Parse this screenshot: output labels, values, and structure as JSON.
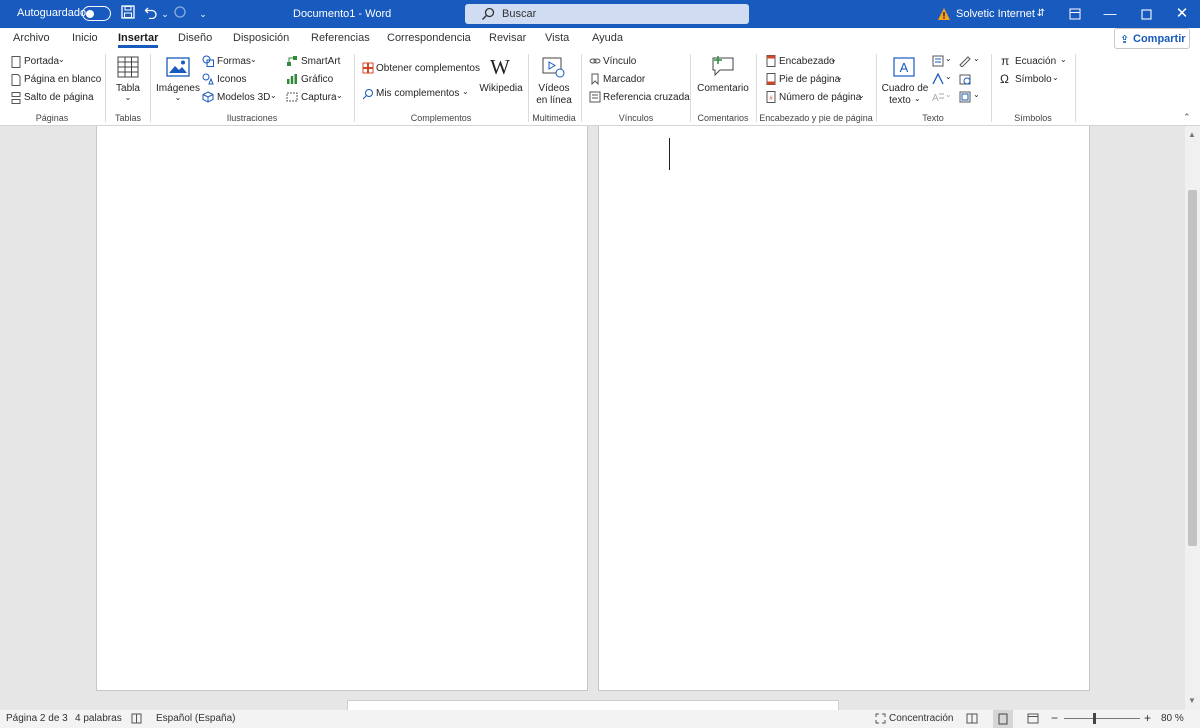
{
  "titlebar": {
    "autosave_label": "Autoguardado",
    "doc_title": "Documento1  -  Word",
    "search_placeholder": "Buscar",
    "user_name": "Solvetic Internet"
  },
  "tabs": [
    "Archivo",
    "Inicio",
    "Insertar",
    "Diseño",
    "Disposición",
    "Referencias",
    "Correspondencia",
    "Revisar",
    "Vista",
    "Ayuda"
  ],
  "active_tab": "Insertar",
  "share_label": "Compartir",
  "ribbon": {
    "paginas": {
      "label": "Páginas",
      "portada": "Portada",
      "pagina_blanco": "Página en blanco",
      "salto": "Salto de página"
    },
    "tablas": {
      "label": "Tablas",
      "tabla": "Tabla"
    },
    "ilustraciones": {
      "label": "Ilustraciones",
      "imagenes": "Imágenes",
      "formas": "Formas",
      "iconos": "Iconos",
      "modelos3d": "Modelos 3D",
      "smartart": "SmartArt",
      "grafico": "Gráfico",
      "captura": "Captura"
    },
    "complementos": {
      "label": "Complementos",
      "obtener": "Obtener complementos",
      "mis": "Mis complementos",
      "wikipedia": "Wikipedia"
    },
    "multimedia": {
      "label": "Multimedia",
      "videos_1": "Vídeos",
      "videos_2": "en línea"
    },
    "vinculos": {
      "label": "Vínculos",
      "vinculo": "Vínculo",
      "marcador": "Marcador",
      "referencia": "Referencia cruzada"
    },
    "comentarios": {
      "label": "Comentarios",
      "comentario": "Comentario"
    },
    "encabezado": {
      "label": "Encabezado y pie de página",
      "encabezado": "Encabezado",
      "pie": "Pie de página",
      "numero": "Número de página"
    },
    "texto": {
      "label": "Texto",
      "cuadro_1": "Cuadro de",
      "cuadro_2": "texto"
    },
    "simbolos": {
      "label": "Símbolos",
      "ecuacion": "Ecuación",
      "simbolo": "Símbolo"
    }
  },
  "status": {
    "page": "Página 2 de 3",
    "words": "4 palabras",
    "language": "Español (España)",
    "focus": "Concentración",
    "zoom": "80 %"
  },
  "colors": {
    "accent": "#185abd",
    "orange": "#d24726",
    "green": "#2f8a3a"
  }
}
